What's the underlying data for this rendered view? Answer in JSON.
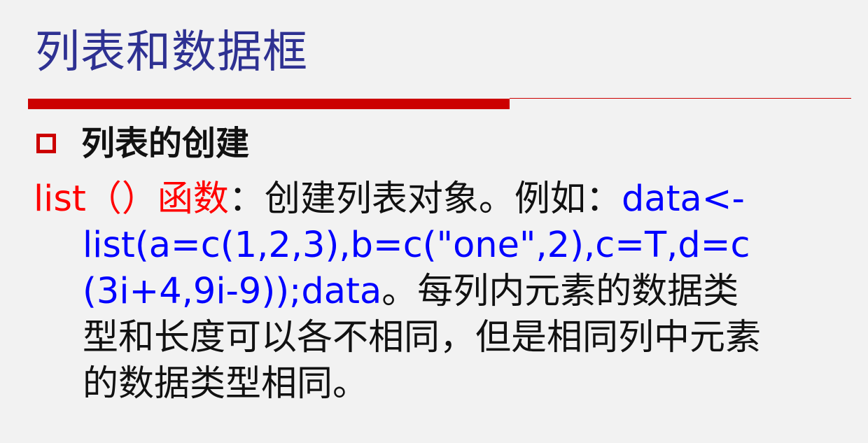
{
  "slide": {
    "title": "列表和数据框",
    "bullet": "列表的创建",
    "body": {
      "line1": {
        "func": "list（）函数",
        "desc": "：创建列表对象。例如：",
        "code": "data<-"
      },
      "line2": {
        "code": "list(a=c(1,2,3),b=c(\"one\",2),c=T,d=c"
      },
      "line3": {
        "code": "(3i+4,9i-9));data",
        "desc": "。每列内元素的数据类"
      },
      "line4": {
        "desc": "型和长度可以各不相同，但是相同列中元素"
      },
      "line5": {
        "desc": "的数据类型相同。"
      }
    },
    "colors": {
      "title": "#2e3192",
      "accent_red": "#cc0000",
      "function_red": "#ff0000",
      "code_blue": "#0000ff",
      "background": "#f2f2f2"
    }
  }
}
